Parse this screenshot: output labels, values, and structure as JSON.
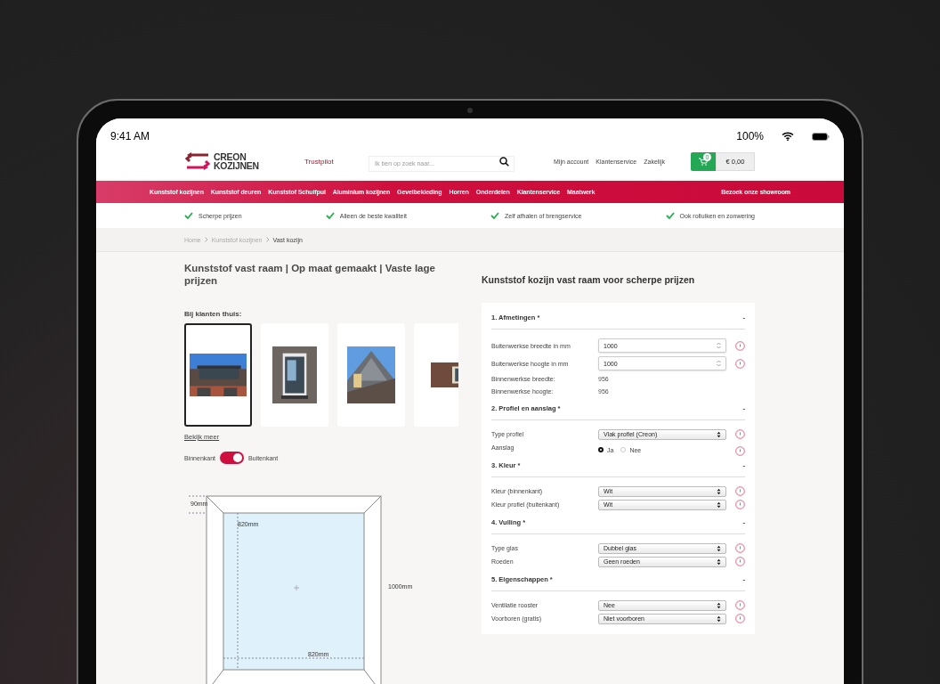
{
  "status_bar": {
    "time": "9:41 AM",
    "battery": "100%"
  },
  "header": {
    "logo": [
      "CREON",
      "KOZIJNEN"
    ],
    "trustpilot": "Trustpilot",
    "search": {
      "placeholder": "Ik ben op zoek naar..."
    },
    "links": [
      "Mijn account",
      "Klantenservice",
      "Zakelijk"
    ],
    "cart": {
      "count": "0",
      "total": "€ 0,00"
    }
  },
  "nav": {
    "items": [
      "Kunststof kozijnen",
      "Kunststof deuren",
      "Kunststof Schuifpui",
      "Aluminium kozijnen",
      "Gevelbekleding",
      "Horren",
      "Onderdelen",
      "Klantenservice",
      "Maatwerk"
    ],
    "showroom": "Bezoek onze showroom"
  },
  "usps": [
    "Scherpe prijzen",
    "Alleen de beste kwaliteit",
    "Zelf afhalen of brengservice",
    "Ook rolluiken en zonwering"
  ],
  "breadcrumb": [
    "Home",
    "Kunststof kozijnen",
    "Vast kozijn"
  ],
  "product": {
    "title": "Kunststof vast raam | Op maat gemaakt | Vaste lage prijzen",
    "gallery_label": "Bij klanten thuis:",
    "gallery": [
      {
        "kind": "picture",
        "selected": true
      },
      {
        "kind": "picture",
        "selected": false
      },
      {
        "kind": "picture",
        "selected": false
      },
      {
        "kind": "picture",
        "selected": false
      }
    ],
    "more_link": "Bekijk meer",
    "toggle": {
      "left": "Binnenkant",
      "right": "Buitenkant",
      "on": true
    },
    "drawing": {
      "frame": "90mm",
      "inner_height": "820mm",
      "outer_height": "1000mm",
      "inner_width": "820mm"
    }
  },
  "config": {
    "title": "Kunststof kozijn vast raam voor scherpe prijzen",
    "sections": [
      {
        "title": "1. Afmetingen *",
        "toggle": "-",
        "rows": [
          {
            "kind": "number",
            "label": "Buitenwerkse breedte in mm",
            "value": "1000"
          },
          {
            "kind": "number",
            "label": "Buitenwerkse hoogte in mm",
            "value": "1000"
          },
          {
            "kind": "static",
            "label": "Binnenwerkse breedte:",
            "value": "956"
          },
          {
            "kind": "static",
            "label": "Binnenwerkse hoogte:",
            "value": "956"
          }
        ]
      },
      {
        "title": "2. Profiel en aanslag *",
        "toggle": "-",
        "rows": [
          {
            "kind": "select",
            "label": "Type profiel",
            "value": "Vlak profiel (Creon)"
          },
          {
            "kind": "radio",
            "label": "Aanslag",
            "options": [
              {
                "label": "Ja",
                "selected": true
              },
              {
                "label": "Nee",
                "selected": false
              }
            ]
          }
        ]
      },
      {
        "title": "3. Kleur *",
        "toggle": "-",
        "rows": [
          {
            "kind": "select",
            "label": "Kleur (binnenkant)",
            "value": "Wit"
          },
          {
            "kind": "select",
            "label": "Kleur profiel (buitenkant)",
            "value": "Wit"
          }
        ]
      },
      {
        "title": "4. Vulling *",
        "toggle": "-",
        "rows": [
          {
            "kind": "select",
            "label": "Type glas",
            "value": "Dubbel glas"
          },
          {
            "kind": "select",
            "label": "Roeden",
            "value": "Geen roeden"
          }
        ]
      },
      {
        "title": "5. Eigenschappen *",
        "toggle": "-",
        "rows": [
          {
            "kind": "select",
            "label": "Ventilatie rooster",
            "value": "Nee"
          },
          {
            "kind": "select",
            "label": "Voorboren (gratis)",
            "value": "Niet voorboren"
          }
        ]
      }
    ]
  }
}
